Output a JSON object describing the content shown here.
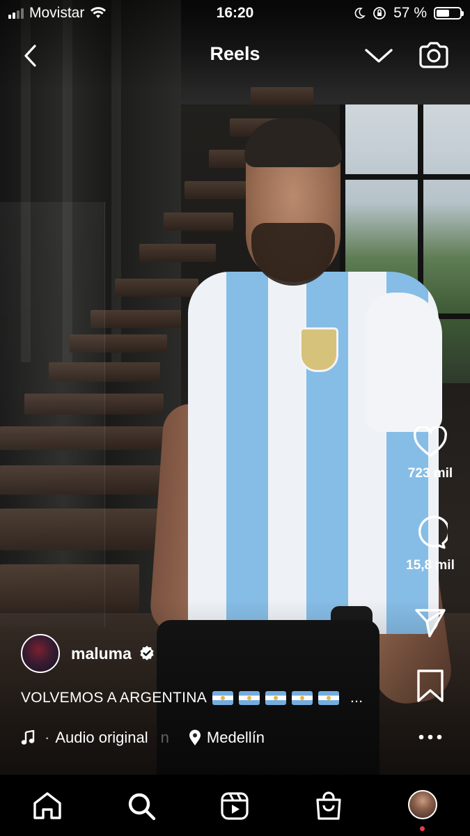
{
  "status_bar": {
    "carrier": "Movistar",
    "time": "16:20",
    "battery": "57 %",
    "battery_level": 0.57
  },
  "header": {
    "title": "Reels",
    "back_icon": "chevron-left-icon",
    "dropdown_icon": "chevron-down-icon",
    "camera_icon": "camera-icon"
  },
  "actions": {
    "likes": "723 mil",
    "comments": "15,8 mil"
  },
  "post": {
    "username": "maluma",
    "verified": true,
    "caption": "VOLVEMOS A ARGENTINA",
    "caption_more": "...",
    "audio": "Audio original",
    "audio_overflow": "n",
    "location": "Medellín"
  },
  "colors": {
    "verified_badge": "#ffffff",
    "notification_dot": "#ed3a4f",
    "argentina_blue": "#74acdf"
  },
  "tabs": [
    "home",
    "search",
    "reels",
    "shop",
    "profile"
  ]
}
